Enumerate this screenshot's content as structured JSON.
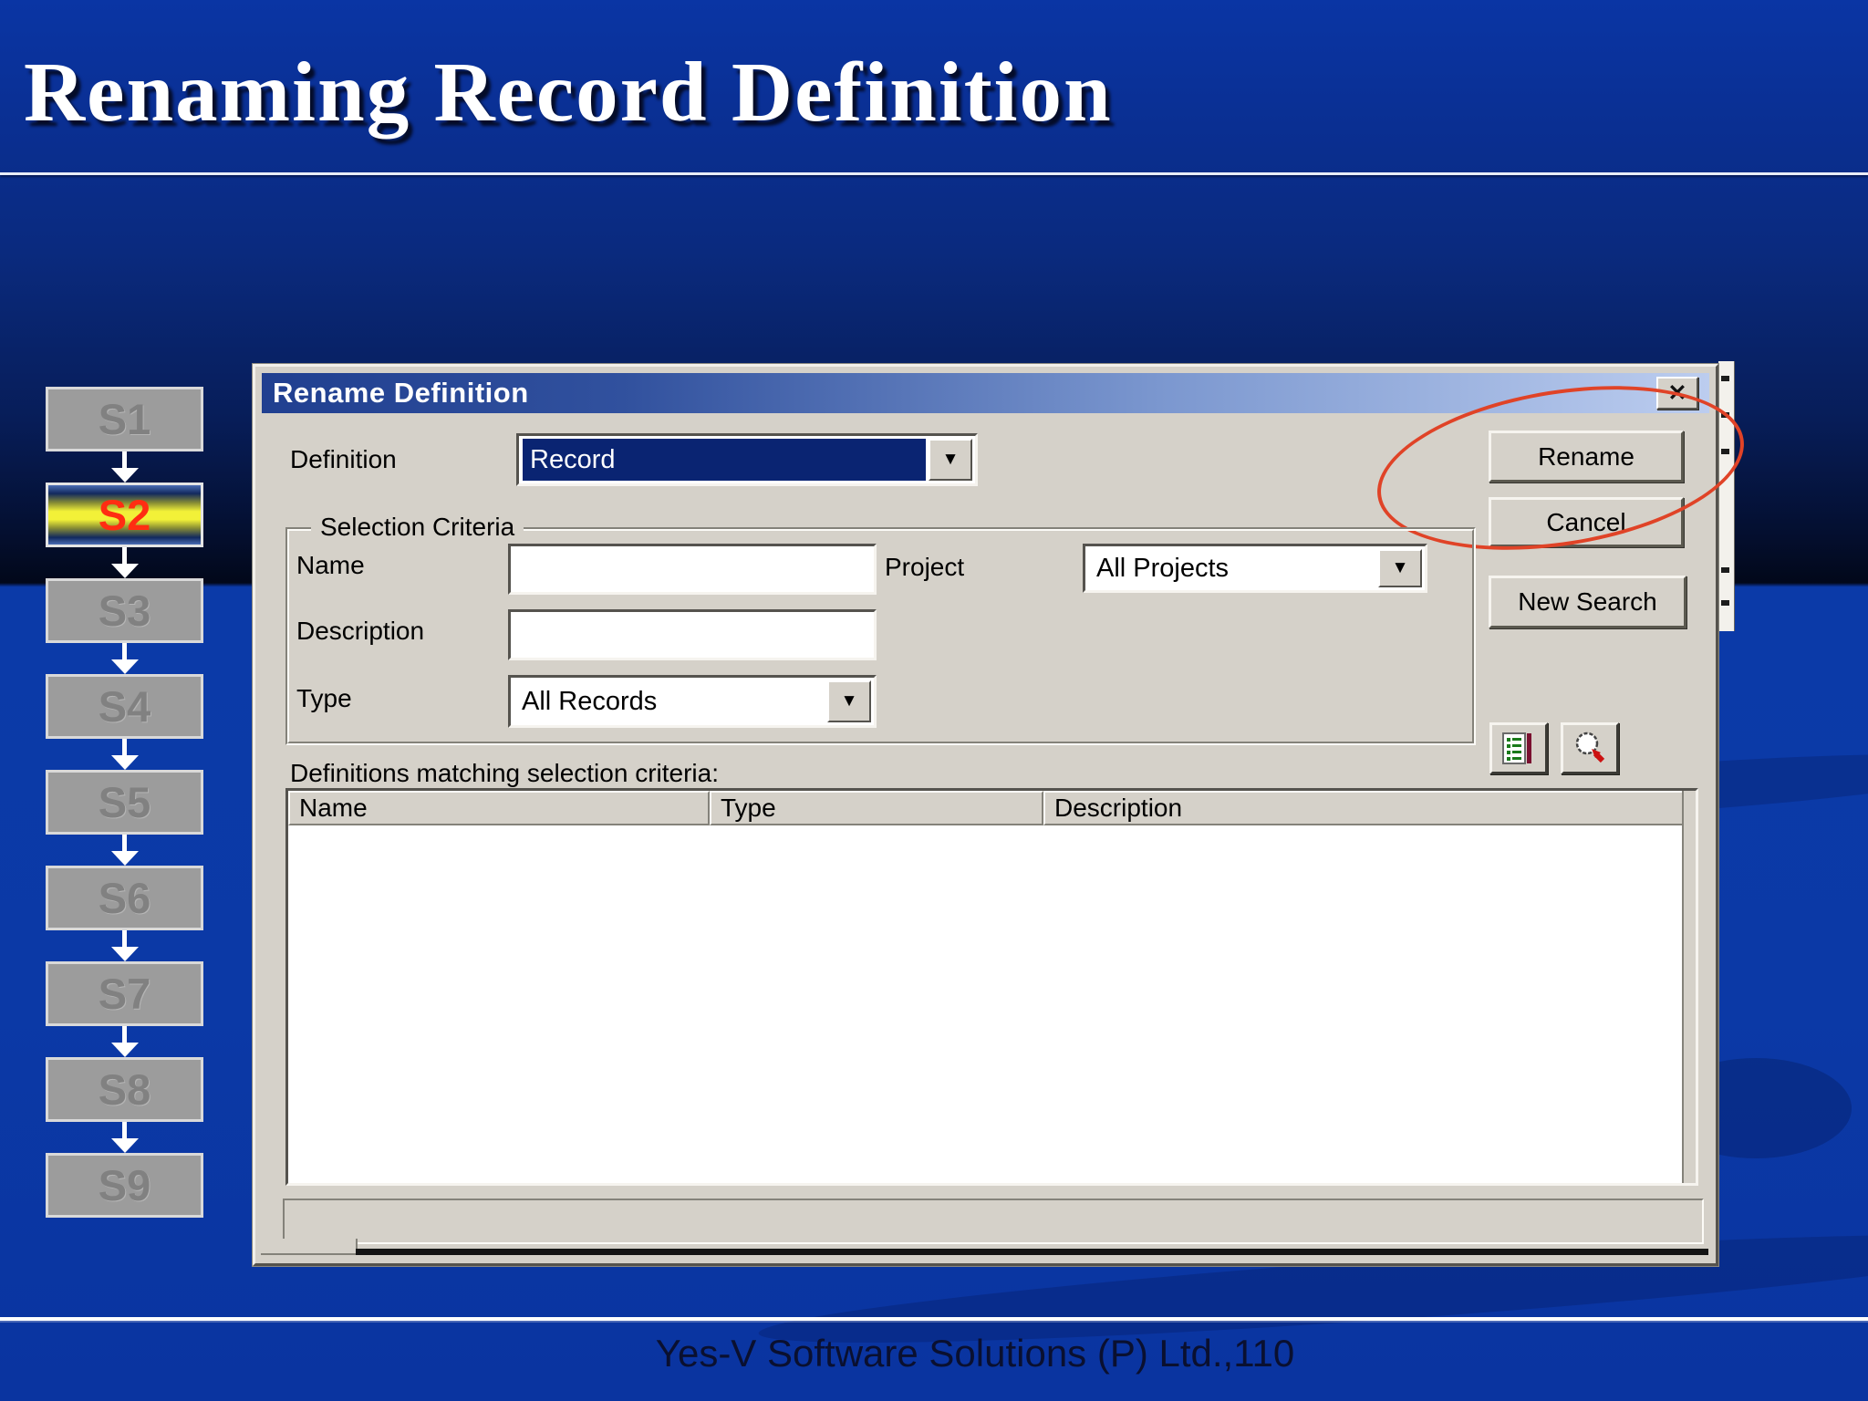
{
  "slide": {
    "title": "Renaming Record Definition",
    "footer": "Yes-V Software Solutions (P) Ltd.,110"
  },
  "flowchart": {
    "steps": [
      {
        "label": "S1",
        "active": false
      },
      {
        "label": "S2",
        "active": true
      },
      {
        "label": "S3",
        "active": false
      },
      {
        "label": "S4",
        "active": false
      },
      {
        "label": "S5",
        "active": false
      },
      {
        "label": "S6",
        "active": false
      },
      {
        "label": "S7",
        "active": false
      },
      {
        "label": "S8",
        "active": false
      },
      {
        "label": "S9",
        "active": false
      }
    ]
  },
  "dialog": {
    "title": "Rename Definition",
    "definition": {
      "label": "Definition",
      "value": "Record"
    },
    "buttons": {
      "rename": "Rename",
      "cancel": "Cancel",
      "new_search": "New Search"
    },
    "selection_criteria": {
      "legend": "Selection Criteria",
      "name_label": "Name",
      "name_value": "",
      "description_label": "Description",
      "description_value": "",
      "type_label": "Type",
      "type_value": "All Records",
      "project_label": "Project",
      "project_value": "All Projects"
    },
    "results": {
      "label": "Definitions matching selection criteria:",
      "columns": [
        "Name",
        "Type",
        "Description"
      ],
      "rows": []
    },
    "statusbar_text": ""
  },
  "icons": {
    "close": "✕",
    "dropdown": "▼"
  },
  "colors": {
    "background_top": "#0a35a4",
    "background_bottom": "#0b39a6",
    "selection_navy": "#0a2472",
    "annotation_red": "#e04327",
    "active_step_yellow": "#f2f138",
    "active_step_text": "#ff2d12",
    "titlebar_left": "#203f90",
    "titlebar_right": "#bccdef",
    "dialog_bg": "#d5d1c9",
    "footer_text": "#0a1030"
  }
}
